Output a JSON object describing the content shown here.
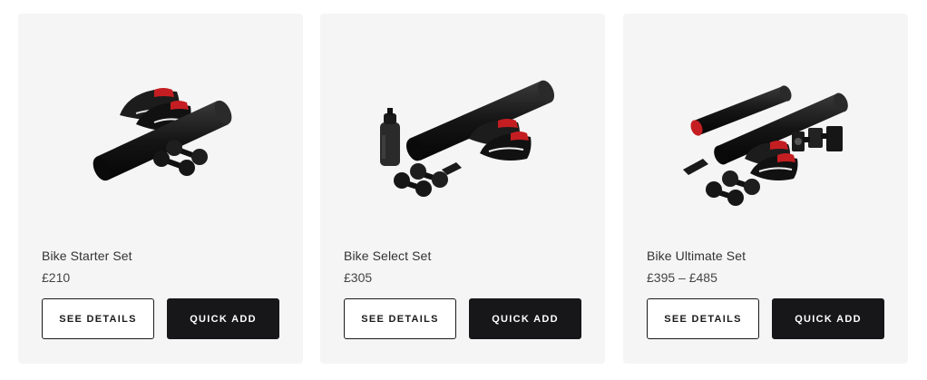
{
  "products": [
    {
      "name": "Bike Starter Set",
      "price": "£210",
      "details_label": "SEE DETAILS",
      "quick_add_label": "QUICK ADD",
      "image": "bike-starter-set-image"
    },
    {
      "name": "Bike Select Set",
      "price": "£305",
      "details_label": "SEE DETAILS",
      "quick_add_label": "QUICK ADD",
      "image": "bike-select-set-image"
    },
    {
      "name": "Bike Ultimate Set",
      "price": "£395 – £485",
      "details_label": "SEE DETAILS",
      "quick_add_label": "QUICK ADD",
      "image": "bike-ultimate-set-image"
    }
  ],
  "colors": {
    "card_bg": "#f5f5f5",
    "button_dark": "#17171a",
    "accent_red": "#c41e22"
  }
}
